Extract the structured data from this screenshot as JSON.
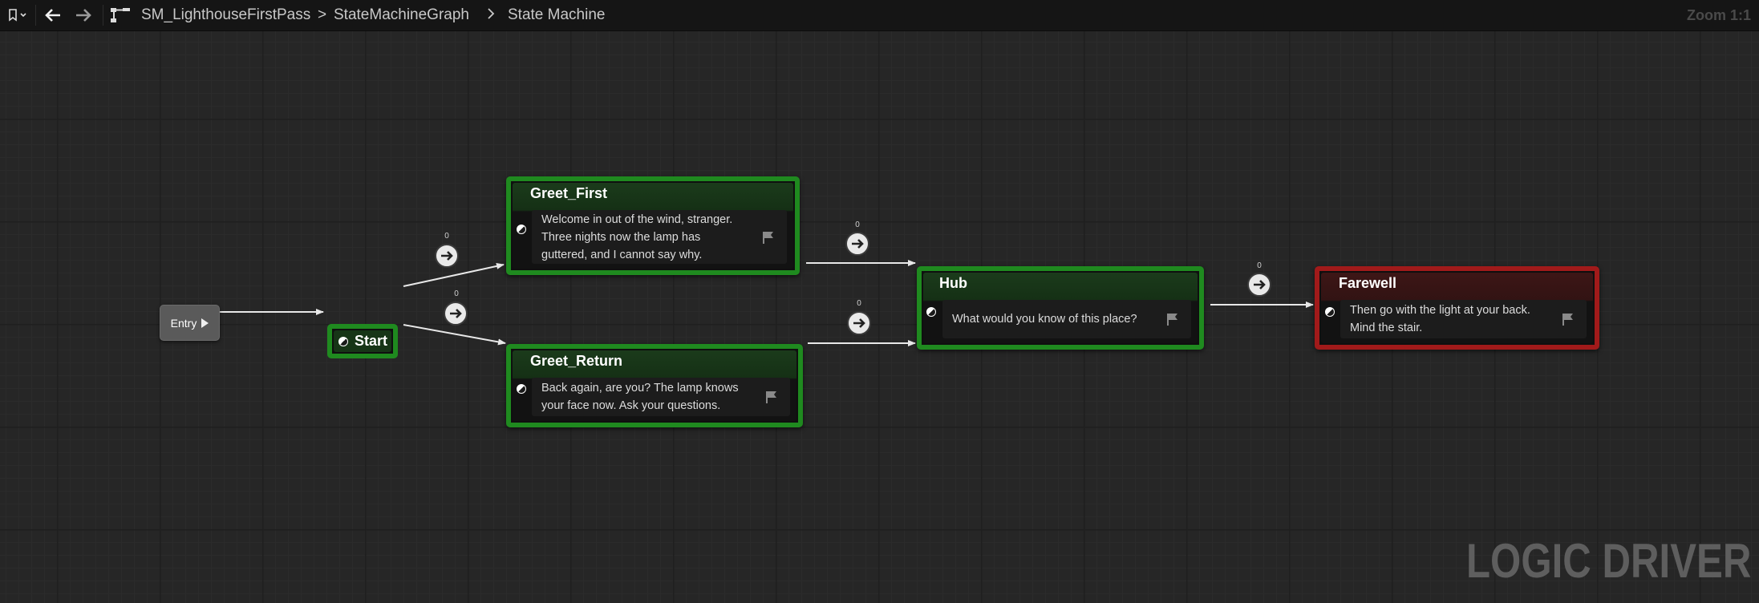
{
  "toolbar": {
    "breadcrumbs": [
      "SM_LighthouseFirstPass",
      "StateMachineGraph",
      "State Machine"
    ],
    "zoom": "Zoom 1:1"
  },
  "graph": {
    "entry": {
      "label": "Entry"
    },
    "start": {
      "label": "Start"
    },
    "states": [
      {
        "id": "greet_first",
        "title": "Greet_First",
        "text": "Welcome in out of the wind, stranger. Three nights now the lamp has guttered, and I cannot say why."
      },
      {
        "id": "greet_return",
        "title": "Greet_Return",
        "text": "Back again, are you? The lamp knows your face now. Ask your questions."
      },
      {
        "id": "hub",
        "title": "Hub",
        "text": "What would you know of this place?"
      },
      {
        "id": "farewell",
        "title": "Farewell",
        "text": "Then go with the light at your back. Mind the stair."
      }
    ],
    "transitions": [
      {
        "from": "Start",
        "to": "Greet_First",
        "priority": "0"
      },
      {
        "from": "Start",
        "to": "Greet_Return",
        "priority": "0"
      },
      {
        "from": "Greet_First",
        "to": "Hub",
        "priority": "0"
      },
      {
        "from": "Greet_Return",
        "to": "Hub",
        "priority": "0"
      },
      {
        "from": "Hub",
        "to": "Farewell",
        "priority": "0"
      }
    ]
  },
  "colors": {
    "state_border": "#1f8a1f",
    "end_state_border": "#a11a1a",
    "canvas_bg": "#262626"
  },
  "watermark": "LOGIC DRIVER"
}
